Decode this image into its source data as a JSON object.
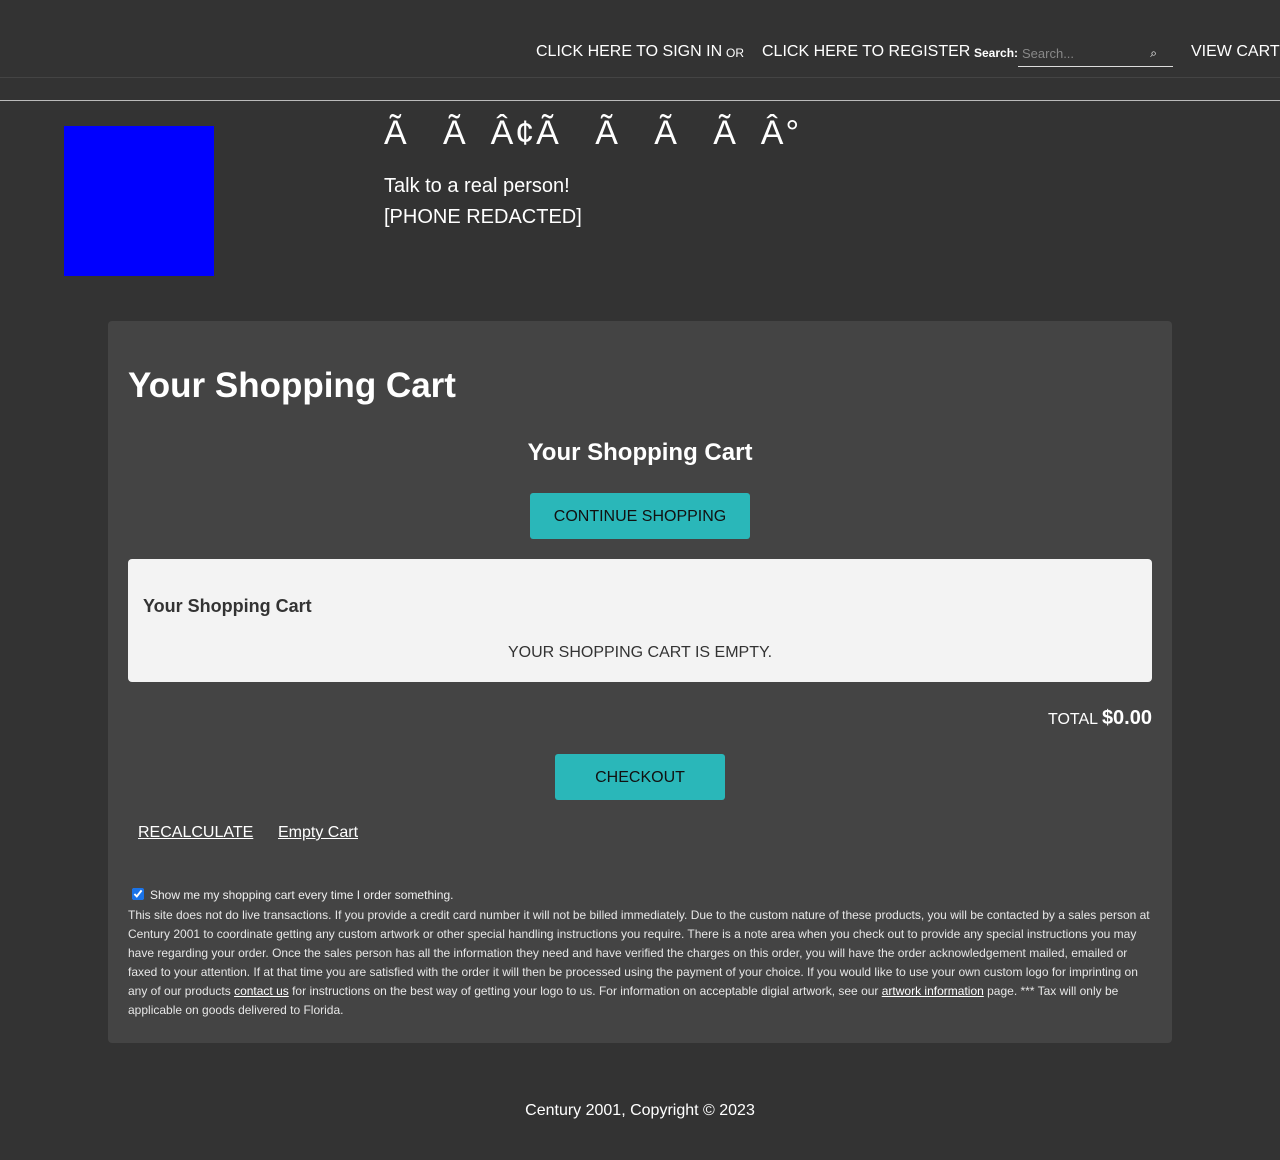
{
  "nav": {
    "sign_in": "CLICK HERE TO SIGN IN",
    "or": "OR",
    "register": "CLICK HERE TO REGISTER",
    "search_label": "Search:",
    "search_placeholder": "Search...",
    "search_button": "⌕",
    "view_cart": "VIEW CART"
  },
  "header": {
    "brand": "Ã   Ã  Â¢Ã   Ã   Ã   Ã  Â°",
    "tagline": "Talk to a real person!",
    "phone": "[PHONE REDACTED]",
    "logo_color": "#0000ff"
  },
  "main": {
    "page_title": "Your Shopping Cart",
    "subtitle": "Your Shopping Cart",
    "continue_label": "CONTINUE SHOPPING",
    "cart_box_title": "Your Shopping Cart",
    "empty_message": "YOUR SHOPPING CART IS EMPTY.",
    "total_label": "TOTAL",
    "total_value": "$0.00",
    "checkout_label": "CHECKOUT",
    "recalculate_label": "RECALCULATE",
    "empty_cart_label": "Empty Cart",
    "show_cart_checked": true,
    "show_cart_label": "Show me my shopping cart every time I order something.",
    "disclaimer": {
      "part1": "This site does not do live transactions. If you provide a credit card number it will not be billed immediately. Due to the custom nature of these products, you will be contacted by a sales person at Century 2001 to coordinate getting any custom artwork or other special handling instructions you require. There is a note area when you check out to provide any special instructions you may have regarding your order. Once the sales person has all the information they need and have verified the charges on this order, you will have the order acknowledgement mailed, emailed or faxed to your attention. If at that time you are satisfied with the order it will then be processed using the payment of your choice. If you would like to use your own custom logo for imprinting on any of our products ",
      "link1": "contact us",
      "part2": " for instructions on the best way of getting your logo to us. For information on acceptable digial artwork, see our ",
      "link2": "artwork information",
      "part3": " page. *** Tax will only be applicable on goods delivered to Florida."
    }
  },
  "footer": {
    "copyright": "Century 2001, Copyright © 2023"
  },
  "colors": {
    "background": "#333333",
    "panel": "#444444",
    "accent": "#2ab7b9",
    "cart_box": "#f3f3f3"
  }
}
